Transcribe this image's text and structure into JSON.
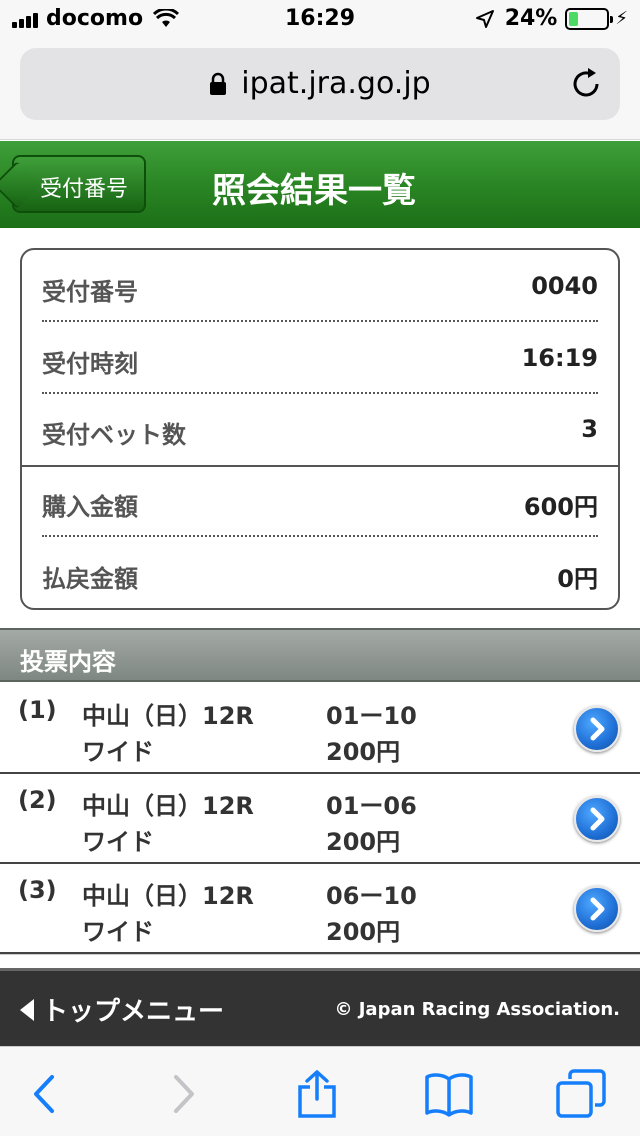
{
  "status": {
    "carrier": "docomo",
    "time": "16:29",
    "battery_pct": "24%",
    "battery_level": 0.24,
    "battery_color": "#4cd964"
  },
  "browser": {
    "url": "ipat.jra.go.jp"
  },
  "header": {
    "back_label": "受付番号",
    "title": "照会結果一覧",
    "accent_color": "#2a8624"
  },
  "summary": {
    "rows": [
      {
        "label": "受付番号",
        "value": "0040"
      },
      {
        "label": "受付時刻",
        "value": "16:19"
      },
      {
        "label": "受付ベット数",
        "value": "3"
      },
      {
        "label": "購入金額",
        "value": "600円"
      },
      {
        "label": "払戻金額",
        "value": "0円"
      }
    ]
  },
  "section": {
    "title": "投票内容"
  },
  "bets": [
    {
      "num": "(1)",
      "race": "中山（日）12R",
      "type": "ワイド",
      "combo": "01ー10",
      "amount": "200円"
    },
    {
      "num": "(2)",
      "race": "中山（日）12R",
      "type": "ワイド",
      "combo": "01ー06",
      "amount": "200円"
    },
    {
      "num": "(3)",
      "race": "中山（日）12R",
      "type": "ワイド",
      "combo": "06ー10",
      "amount": "200円"
    }
  ],
  "footer": {
    "top_menu": "トップメニュー",
    "copyright": "© Japan Racing Association."
  },
  "toolbar": {
    "icons": [
      "back-arrow-icon",
      "forward-arrow-icon",
      "share-icon",
      "bookmarks-icon",
      "tabs-icon"
    ]
  }
}
